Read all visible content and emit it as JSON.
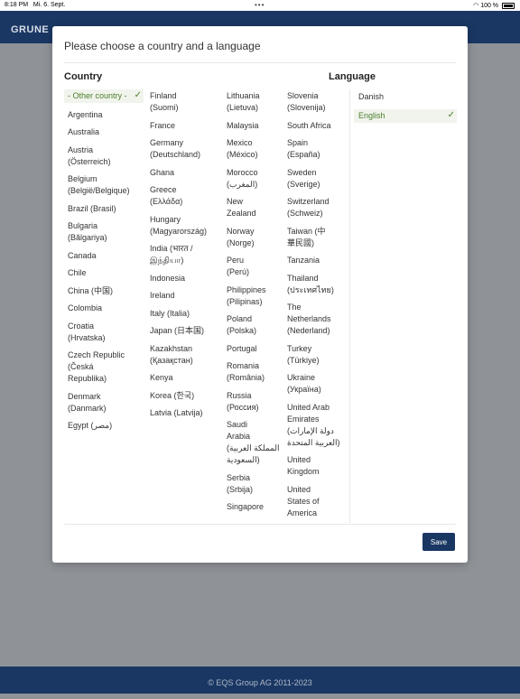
{
  "status_bar": {
    "time": "8:18 PM",
    "date": "Mi. 6. Sept.",
    "dots": "•••",
    "battery": "100 %"
  },
  "header": {
    "logo": "GRUNE"
  },
  "footer": {
    "copyright": "© EQS Group AG 2011-2023"
  },
  "modal": {
    "title": "Please choose a country and a language",
    "country_heading": "Country",
    "language_heading": "Language",
    "save_label": "Save",
    "selected_check": "✓"
  },
  "countries": {
    "col1": [
      "- Other country -",
      "Argentina",
      "Australia",
      "Austria\n(Österreich)",
      "Belgium\n(België/Belgique)",
      "Brazil (Brasil)",
      "Bulgaria\n(Bălgariya)",
      "Canada",
      "Chile",
      "China (中国)",
      "Colombia",
      "Croatia\n(Hrvatska)",
      "Czech Republic\n(Česká\nRepublika)",
      "Denmark\n(Danmark)",
      "Egypt (مصر)"
    ],
    "col2": [
      "Finland\n(Suomi)",
      "France",
      "Germany\n(Deutschland)",
      "Ghana",
      "Greece\n(Ελλάδα)",
      "Hungary\n(Magyarország)",
      "India (भारत /\nஇந்தியா)",
      "Indonesia",
      "Ireland",
      "Italy (Italia)",
      "Japan (日本国)",
      "Kazakhstan\n(Қазақстан)",
      "Kenya",
      "Korea (한국)",
      "Latvia (Latvija)"
    ],
    "col3": [
      "Lithuania\n(Lietuva)",
      "Malaysia",
      "Mexico\n(México)",
      "Morocco\n(المغرب)",
      "New\nZealand",
      "Norway\n(Norge)",
      "Peru\n(Perú)",
      "Philippines\n(Pilipinas)",
      "Poland\n(Polska)",
      "Portugal",
      "Romania\n(România)",
      "Russia\n(Россия)",
      "Saudi\nArabia\n(المملكة العربية\nالسعودية)",
      "Serbia\n(Srbija)",
      "Singapore"
    ],
    "col4": [
      "Slovenia\n(Slovenija)",
      "South Africa",
      "Spain\n(España)",
      "Sweden\n(Sverige)",
      "Switzerland\n(Schweiz)",
      "Taiwan (中\n華民國)",
      "Tanzania",
      "Thailand\n(ประเทศไทย)",
      "The\nNetherlands\n(Nederland)",
      "Turkey\n(Türkiye)",
      "Ukraine\n(Україна)",
      "United Arab\nEmirates\n(دولة الإمارات\nالعربية المتحدة)",
      "United\nKingdom",
      "United\nStates of\nAmerica"
    ]
  },
  "languages": [
    "Danish",
    "English"
  ],
  "selection": {
    "country": "- Other country -",
    "language": "English"
  },
  "colors": {
    "header_bg": "#1a3763",
    "selected_text": "#4a7f2d",
    "selected_bg": "#f1f4ec"
  }
}
